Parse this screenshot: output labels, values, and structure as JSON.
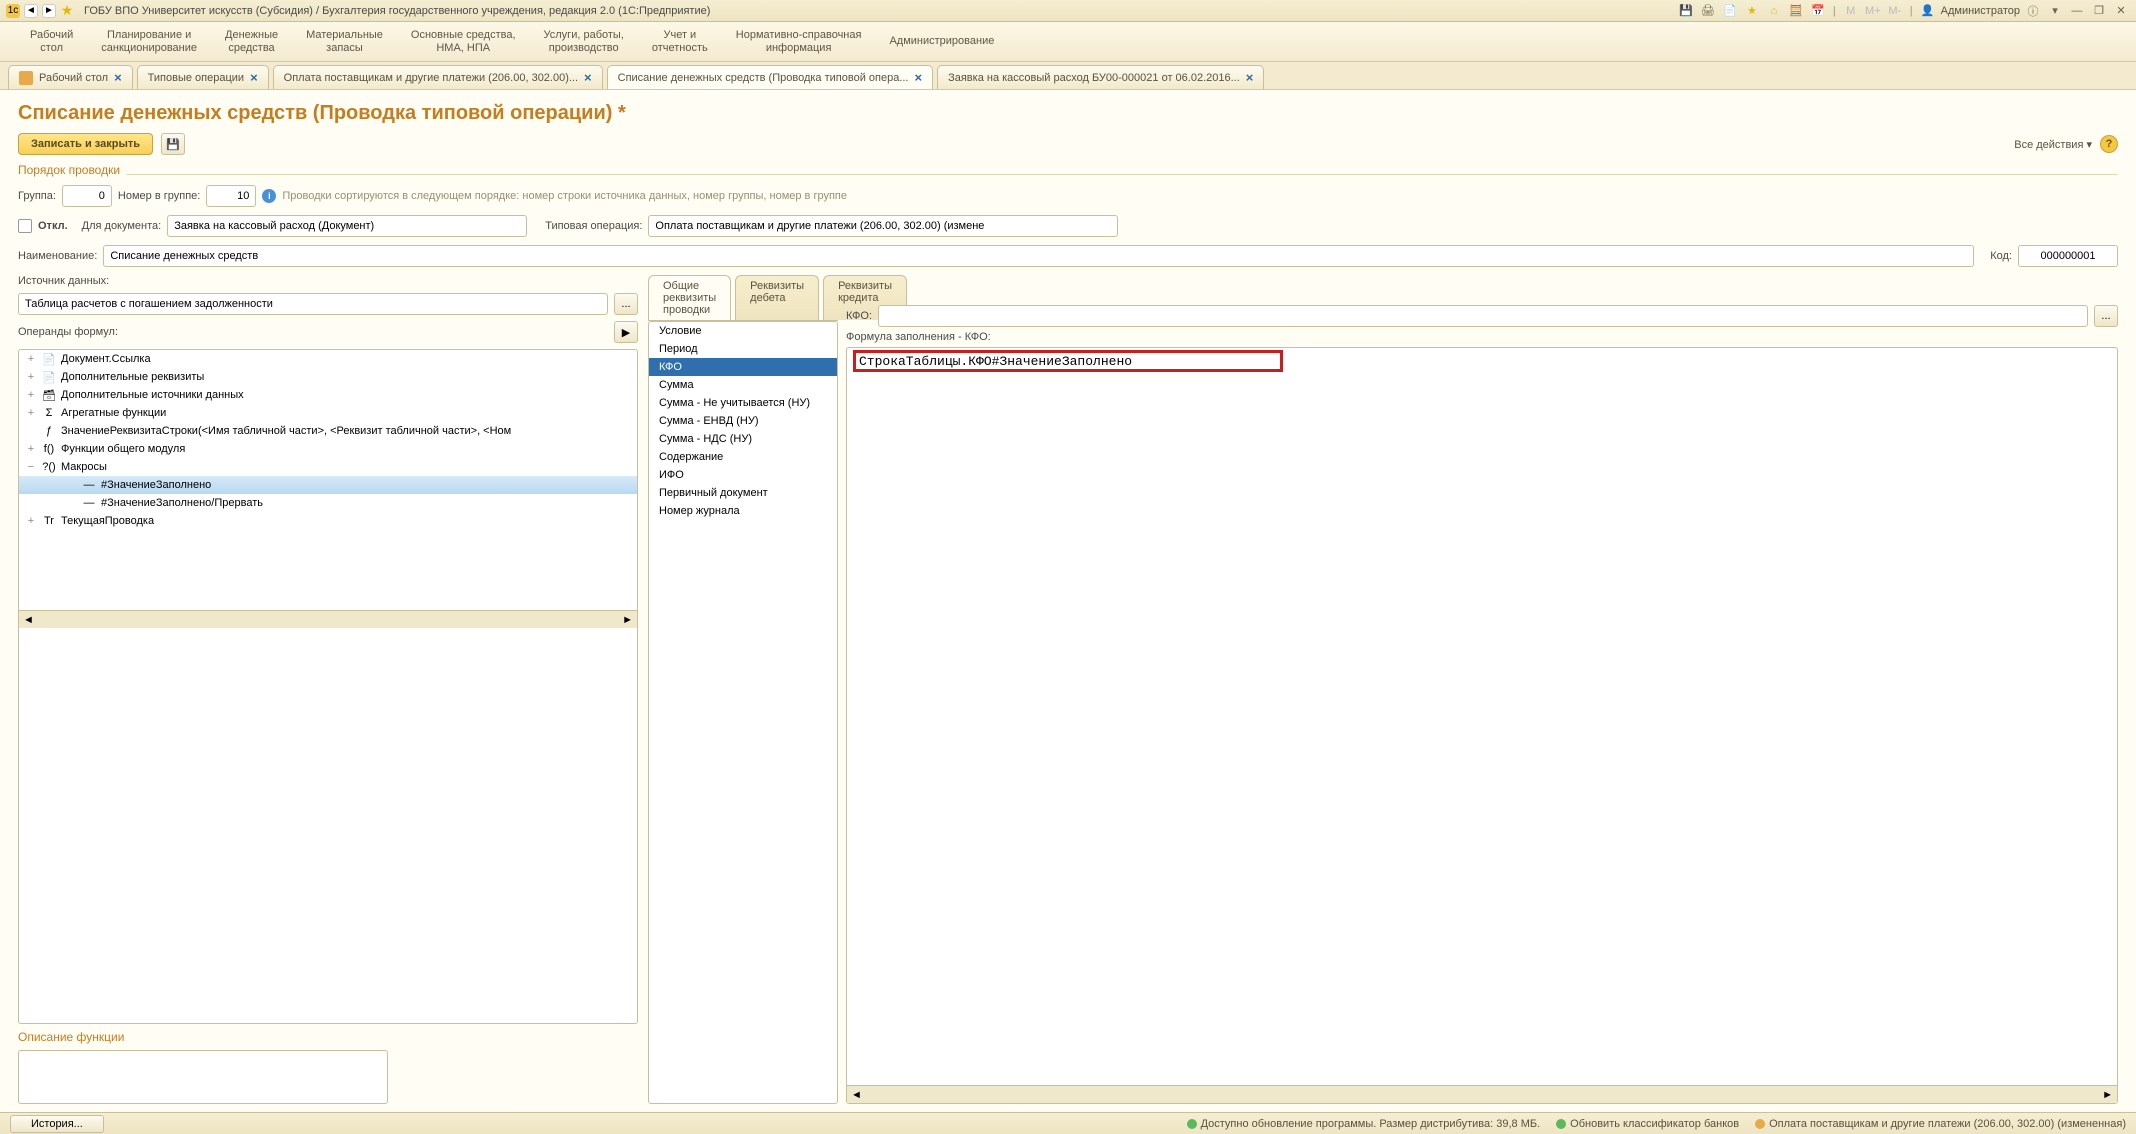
{
  "titlebar": {
    "app_title": "ГОБУ ВПО Университет искусств (Субсидия) / Бухгалтерия государственного учреждения, редакция 2.0  (1С:Предприятие)",
    "user_label": "Администратор"
  },
  "topnav": [
    "Рабочий\nстол",
    "Планирование и\nсанкционирование",
    "Денежные\nсредства",
    "Материальные\nзапасы",
    "Основные средства,\nНМА, НПА",
    "Услуги, работы,\nпроизводство",
    "Учет и\nотчетность",
    "Нормативно-справочная\nинформация",
    "Администрирование"
  ],
  "tabs": [
    {
      "label": "Рабочий стол",
      "closable": true,
      "icon": true
    },
    {
      "label": "Типовые операции",
      "closable": true
    },
    {
      "label": "Оплата поставщикам и другие платежи (206.00, 302.00)...",
      "closable": true
    },
    {
      "label": "Списание денежных средств (Проводка типовой опера...",
      "closable": true,
      "active": true
    },
    {
      "label": "Заявка на кассовый расход БУ00-000021 от 06.02.2016...",
      "closable": true
    }
  ],
  "page_title": "Списание денежных средств (Проводка типовой операции) *",
  "actions": {
    "save_close": "Записать и закрыть",
    "all_actions": "Все действия"
  },
  "order": {
    "section": "Порядок проводки",
    "group_lbl": "Группа:",
    "group_val": "0",
    "num_lbl": "Номер в группе:",
    "num_val": "10",
    "hint": "Проводки сортируются в следующем порядке: номер строки источника данных, номер группы,  номер в группе"
  },
  "doc": {
    "off_lbl": "Откл.",
    "for_doc_lbl": "Для документа:",
    "for_doc_val": "Заявка на кассовый расход (Документ)",
    "typop_lbl": "Типовая операция:",
    "typop_val": "Оплата поставщикам и другие платежи (206.00, 302.00) (измене"
  },
  "name": {
    "lbl": "Наименование:",
    "val": "Списание денежных средств",
    "code_lbl": "Код:",
    "code_val": "000000001"
  },
  "datasource": {
    "lbl": "Источник данных:",
    "val": "Таблица расчетов с погашением задолженности"
  },
  "operands": {
    "lbl": "Операнды формул:",
    "tree": [
      {
        "indent": 0,
        "toggle": "+",
        "icon": "📄",
        "text": "Документ.Ссылка"
      },
      {
        "indent": 0,
        "toggle": "+",
        "icon": "📄",
        "text": "Дополнительные реквизиты"
      },
      {
        "indent": 0,
        "toggle": "+",
        "icon": "🗃",
        "text": "Дополнительные источники данных"
      },
      {
        "indent": 0,
        "toggle": "+",
        "icon": "Σ",
        "text": "Агрегатные функции"
      },
      {
        "indent": 0,
        "toggle": "",
        "icon": "ƒ",
        "text": "ЗначениеРеквизитаСтроки(<Имя табличной части>, <Реквизит табличной части>, <Ном"
      },
      {
        "indent": 0,
        "toggle": "+",
        "icon": "f()",
        "text": "Функции общего модуля"
      },
      {
        "indent": 0,
        "toggle": "−",
        "icon": "?()",
        "text": "Макросы"
      },
      {
        "indent": 1,
        "toggle": "",
        "icon": "—",
        "text": "#ЗначениеЗаполнено",
        "sel": true
      },
      {
        "indent": 1,
        "toggle": "",
        "icon": "—",
        "text": "#ЗначениеЗаполнено/Прервать"
      },
      {
        "indent": 0,
        "toggle": "+",
        "icon": "Tr",
        "text": "ТекущаяПроводка"
      }
    ]
  },
  "func_desc_lbl": "Описание функции",
  "subtabs": [
    "Общие реквизиты проводки",
    "Реквизиты дебета",
    "Реквизиты кредита"
  ],
  "req_list": [
    "Условие",
    "Период",
    "КФО",
    "Сумма",
    "Сумма - Не учитывается (НУ)",
    "Сумма - ЕНВД (НУ)",
    "Сумма - НДС (НУ)",
    "Содержание",
    "ИФО",
    "Первичный документ",
    "Номер журнала"
  ],
  "req_selected": 2,
  "kfo": {
    "lbl": "КФО:",
    "val": "",
    "formula_lbl": "Формула заполнения - КФО:",
    "formula_val": "СтрокаТаблицы.КФО#ЗначениеЗаполнено"
  },
  "status": {
    "history": "История...",
    "upd": "Доступно обновление программы. Размер дистрибутива: 39,8 МБ.",
    "bank": "Обновить классификатор банков",
    "pay": "Оплата поставщикам и другие платежи (206.00, 302.00) (измененная)"
  }
}
